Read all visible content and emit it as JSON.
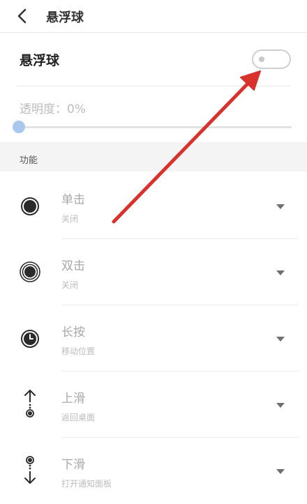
{
  "header": {
    "title": "悬浮球",
    "back_icon": "chevron-left-icon"
  },
  "toggle": {
    "label": "悬浮球",
    "state": "off"
  },
  "opacity": {
    "label": "透明度：0%",
    "value": 0
  },
  "section": {
    "label": "功能"
  },
  "items": [
    {
      "name": "单击",
      "action": "关闭",
      "icon": "dot-circle-icon"
    },
    {
      "name": "双击",
      "action": "关闭",
      "icon": "double-circle-icon"
    },
    {
      "name": "长按",
      "action": "移动位置",
      "icon": "clock-icon"
    },
    {
      "name": "上滑",
      "action": "返回桌面",
      "icon": "swipe-up-icon"
    },
    {
      "name": "下滑",
      "action": "打开通知面板",
      "icon": "swipe-down-icon"
    }
  ],
  "colors": {
    "annotation_arrow": "#d9312c",
    "slider_thumb": "#a9c8ee"
  }
}
